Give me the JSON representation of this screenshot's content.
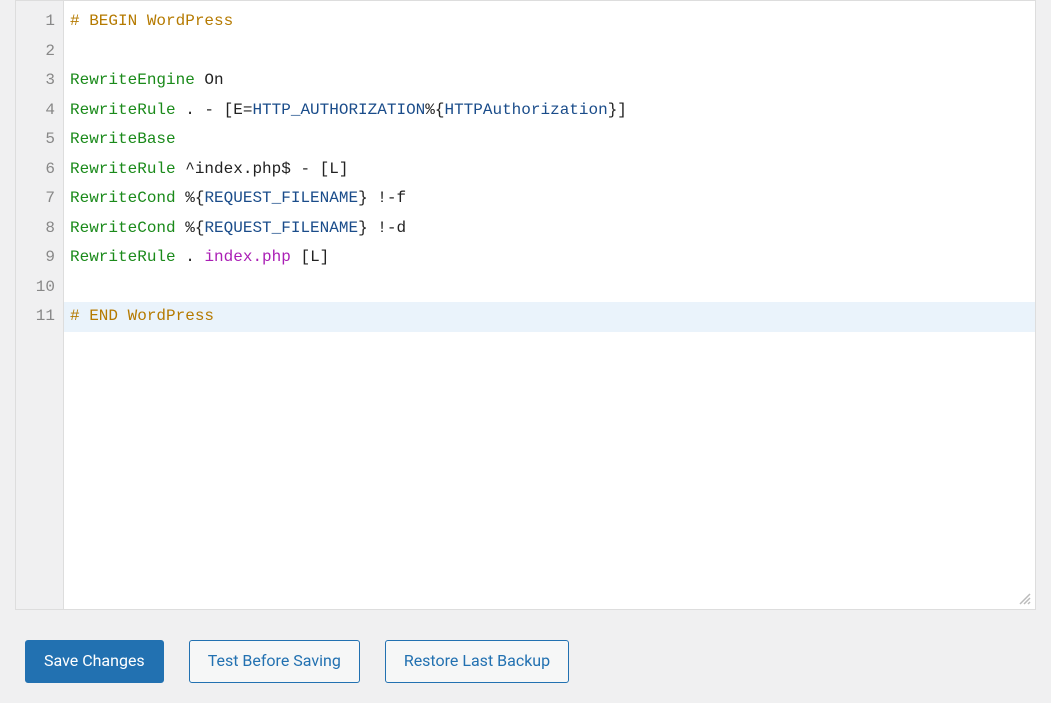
{
  "editor": {
    "lines": [
      {
        "num": "1",
        "tokens": [
          {
            "cls": "comment",
            "t": "# BEGIN WordPress"
          }
        ],
        "hl": false
      },
      {
        "num": "2",
        "tokens": [],
        "hl": false
      },
      {
        "num": "3",
        "tokens": [
          {
            "cls": "keyword",
            "t": "RewriteEngine"
          },
          {
            "cls": "text",
            "t": " On"
          }
        ],
        "hl": false
      },
      {
        "num": "4",
        "tokens": [
          {
            "cls": "keyword",
            "t": "RewriteRule"
          },
          {
            "cls": "text",
            "t": " . - [E="
          },
          {
            "cls": "var",
            "t": "HTTP_AUTHORIZATION"
          },
          {
            "cls": "text",
            "t": "%{"
          },
          {
            "cls": "var",
            "t": "HTTPAuthorization"
          },
          {
            "cls": "text",
            "t": "}]"
          }
        ],
        "hl": false
      },
      {
        "num": "5",
        "tokens": [
          {
            "cls": "keyword",
            "t": "RewriteBase"
          }
        ],
        "hl": false
      },
      {
        "num": "6",
        "tokens": [
          {
            "cls": "keyword",
            "t": "RewriteRule"
          },
          {
            "cls": "text",
            "t": " ^index.php$ - [L]"
          }
        ],
        "hl": false
      },
      {
        "num": "7",
        "tokens": [
          {
            "cls": "keyword",
            "t": "RewriteCond"
          },
          {
            "cls": "text",
            "t": " %{"
          },
          {
            "cls": "var",
            "t": "REQUEST_FILENAME"
          },
          {
            "cls": "text",
            "t": "} !-f"
          }
        ],
        "hl": false
      },
      {
        "num": "8",
        "tokens": [
          {
            "cls": "keyword",
            "t": "RewriteCond"
          },
          {
            "cls": "text",
            "t": " %{"
          },
          {
            "cls": "var",
            "t": "REQUEST_FILENAME"
          },
          {
            "cls": "text",
            "t": "} !-d"
          }
        ],
        "hl": false
      },
      {
        "num": "9",
        "tokens": [
          {
            "cls": "keyword",
            "t": "RewriteRule"
          },
          {
            "cls": "text",
            "t": " . "
          },
          {
            "cls": "string",
            "t": "index.php"
          },
          {
            "cls": "text",
            "t": " [L]"
          }
        ],
        "hl": false
      },
      {
        "num": "10",
        "tokens": [],
        "hl": false
      },
      {
        "num": "11",
        "tokens": [
          {
            "cls": "comment",
            "t": "# END WordPress"
          }
        ],
        "hl": true
      }
    ]
  },
  "buttons": {
    "save": "Save Changes",
    "test": "Test Before Saving",
    "restore": "Restore Last Backup"
  }
}
